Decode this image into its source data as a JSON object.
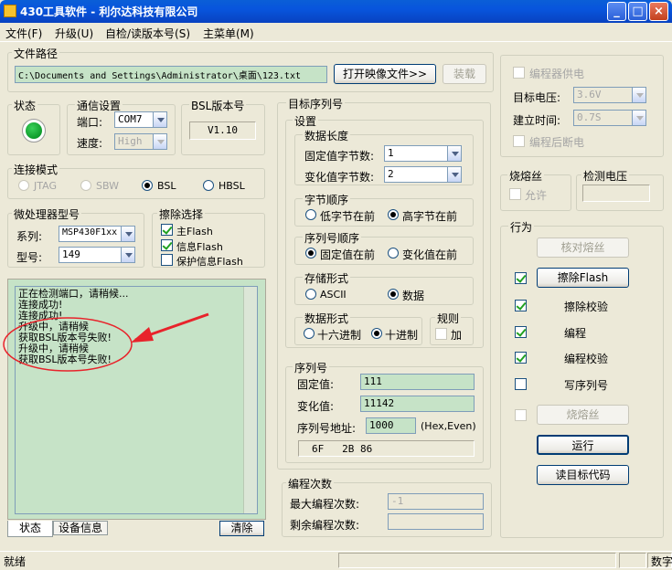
{
  "window": {
    "title": "430工具软件  - 利尔达科技有限公司"
  },
  "menu": [
    "文件(F)",
    "升级(U)",
    "自检/读版本号(S)",
    "主菜单(M)"
  ],
  "file_path": {
    "label": "文件路径",
    "value": "C:\\Documents and Settings\\Administrator\\桌面\\123.txt",
    "open_button": "打开映像文件>>",
    "load_button": "装载"
  },
  "status_group": {
    "label": "状态"
  },
  "comm": {
    "label": "通信设置",
    "port_label": "端口:",
    "port_value": "COM7",
    "speed_label": "速度:",
    "speed_value": "High"
  },
  "bsl": {
    "label": "BSL版本号",
    "value": "V1.10"
  },
  "connect_mode": {
    "label": "连接模式",
    "options": [
      "JTAG",
      "SBW",
      "BSL",
      "HBSL"
    ],
    "selected": "BSL"
  },
  "mcu": {
    "label": "微处理器型号",
    "series_label": "系列:",
    "series_value": "MSP430F1xx",
    "model_label": "型号:",
    "model_value": "149"
  },
  "erase": {
    "label": "擦除选择",
    "items": [
      "主Flash",
      "信息Flash",
      "保护信息Flash"
    ]
  },
  "log": {
    "lines": [
      "正在检测端口，请稍候...",
      "连接成功!",
      "连接成功!",
      "升级中，请稍候",
      "获取BSL版本号失败!",
      "升级中，请稍候",
      "获取BSL版本号失败!"
    ]
  },
  "tabs": {
    "status": "状态",
    "device": "设备信息",
    "clear": "清除"
  },
  "serial": {
    "label": "目标序列号",
    "settings_label": "设置",
    "data_length": {
      "label": "数据长度",
      "fixed_label": "固定值字节数:",
      "fixed_value": "1",
      "var_label": "变化值字节数:",
      "var_value": "2"
    },
    "byte_order": {
      "label": "字节顺序",
      "options": [
        "低字节在前",
        "高字节在前"
      ],
      "selected": "高字节在前"
    },
    "serial_order": {
      "label": "序列号顺序",
      "options": [
        "固定值在前",
        "变化值在前"
      ],
      "selected": "固定值在前"
    },
    "storage": {
      "label": "存储形式",
      "options": [
        "ASCII",
        "数据"
      ],
      "selected": "数据"
    },
    "data_format": {
      "label": "数据形式",
      "options": [
        "十六进制",
        "十进制"
      ],
      "selected": "十进制"
    },
    "rule": {
      "label": "规则",
      "add": "加"
    },
    "number": {
      "label": "序列号",
      "fixed_label": "固定值:",
      "fixed_value": "111",
      "var_label": "变化值:",
      "var_value": "11142",
      "addr_label": "序列号地址:",
      "addr_value": "1000",
      "addr_hint": "(Hex,Even)",
      "preview": "6F   2B 86"
    }
  },
  "program_count": {
    "label": "编程次数",
    "max_label": "最大编程次数:",
    "max_value": "-1",
    "remain_label": "剩余编程次数:",
    "remain_value": ""
  },
  "power": {
    "programmer_power": "编程器供电",
    "voltage_label": "目标电压:",
    "voltage_value": "3.6V",
    "setup_label": "建立时间:",
    "setup_value": "0.7S",
    "power_off": "编程后断电"
  },
  "fuse": {
    "label": "烧熔丝",
    "allow": "允许"
  },
  "detect_voltage": {
    "label": "检测电压",
    "value": ""
  },
  "actions": {
    "label": "行为",
    "verify_fuse": "核对熔丝",
    "erase_flash": "擦除Flash",
    "erase_verify": "擦除校验",
    "program": "编程",
    "program_verify": "编程校验",
    "write_serial": "写序列号",
    "burn_fuse": "烧熔丝",
    "run": "运行",
    "read_target": "读目标代码"
  },
  "statusbar": {
    "text": "就绪",
    "mode": "数字"
  },
  "colors": {
    "title_bar": "#0855DD",
    "log_bg": "#C6E3C7",
    "led_green": "#0E9B2B",
    "annotation_red": "#E8232B"
  }
}
